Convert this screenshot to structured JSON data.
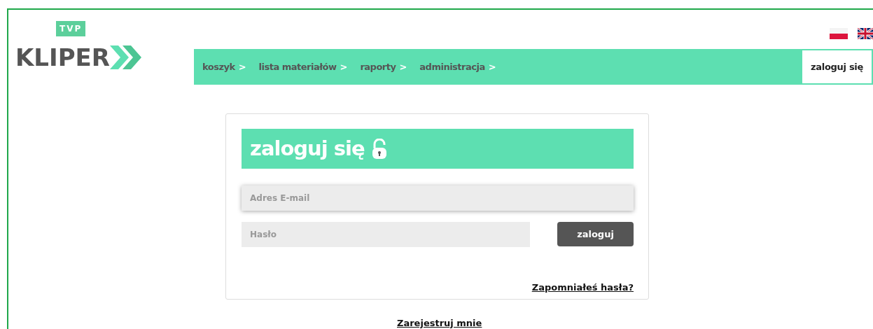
{
  "logo": {
    "badge": "TVP",
    "name": "KLIPER"
  },
  "languages": [
    {
      "kind": "poland"
    },
    {
      "kind": "britain"
    }
  ],
  "nav": {
    "items": [
      {
        "label": "koszyk",
        "arrow": ">"
      },
      {
        "label": "lista materiałów",
        "arrow": ">"
      },
      {
        "label": "raporty",
        "arrow": ">"
      },
      {
        "label": "administracja",
        "arrow": ">"
      }
    ],
    "login": "zaloguj się"
  },
  "login_form": {
    "title": "zaloguj się",
    "email": {
      "placeholder": "Adres E-mail"
    },
    "password": {
      "placeholder": "Hasło"
    },
    "submit": "zaloguj",
    "forgot": "Zapomniałeś hasła?"
  },
  "register": "Zarejestruj mnie"
}
